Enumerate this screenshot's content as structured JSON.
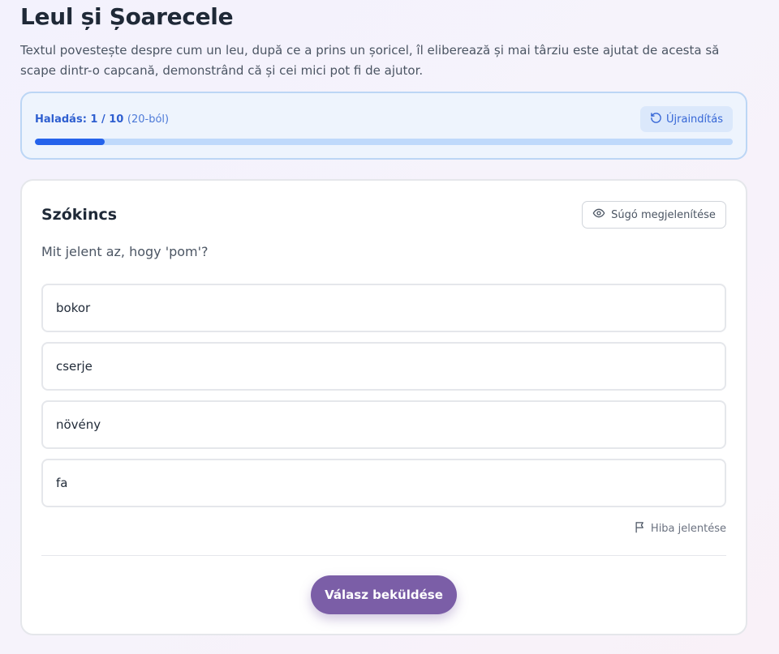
{
  "header": {
    "title": "Leul și Șoarecele",
    "description": "Textul povestește despre cum un leu, după ce a prins un șoricel, îl eliberează și mai târziu este ajutat de acesta să scape dintr-o capcană, demonstrând că și cei mici pot fi de ajutor."
  },
  "progress": {
    "label": "Haladás: 1 / 10",
    "total_text": "(20-ból)",
    "fraction": 0.1,
    "restart_label": "Újraindítás",
    "restart_icon": "rotate-ccw-icon"
  },
  "quiz": {
    "section": "Szókincs",
    "hint_label": "Súgó megjelenítése",
    "hint_icon": "eye-icon",
    "question": "Mit jelent az, hogy 'pom'?",
    "options": [
      "bokor",
      "cserje",
      "növény",
      "fa"
    ],
    "report_label": "Hiba jelentése",
    "report_icon": "flag-icon",
    "submit_label": "Válasz beküldése"
  },
  "colors": {
    "accent": "#2563eb",
    "submit": "#7b5ea7",
    "progress_bg": "#eef4fd"
  }
}
